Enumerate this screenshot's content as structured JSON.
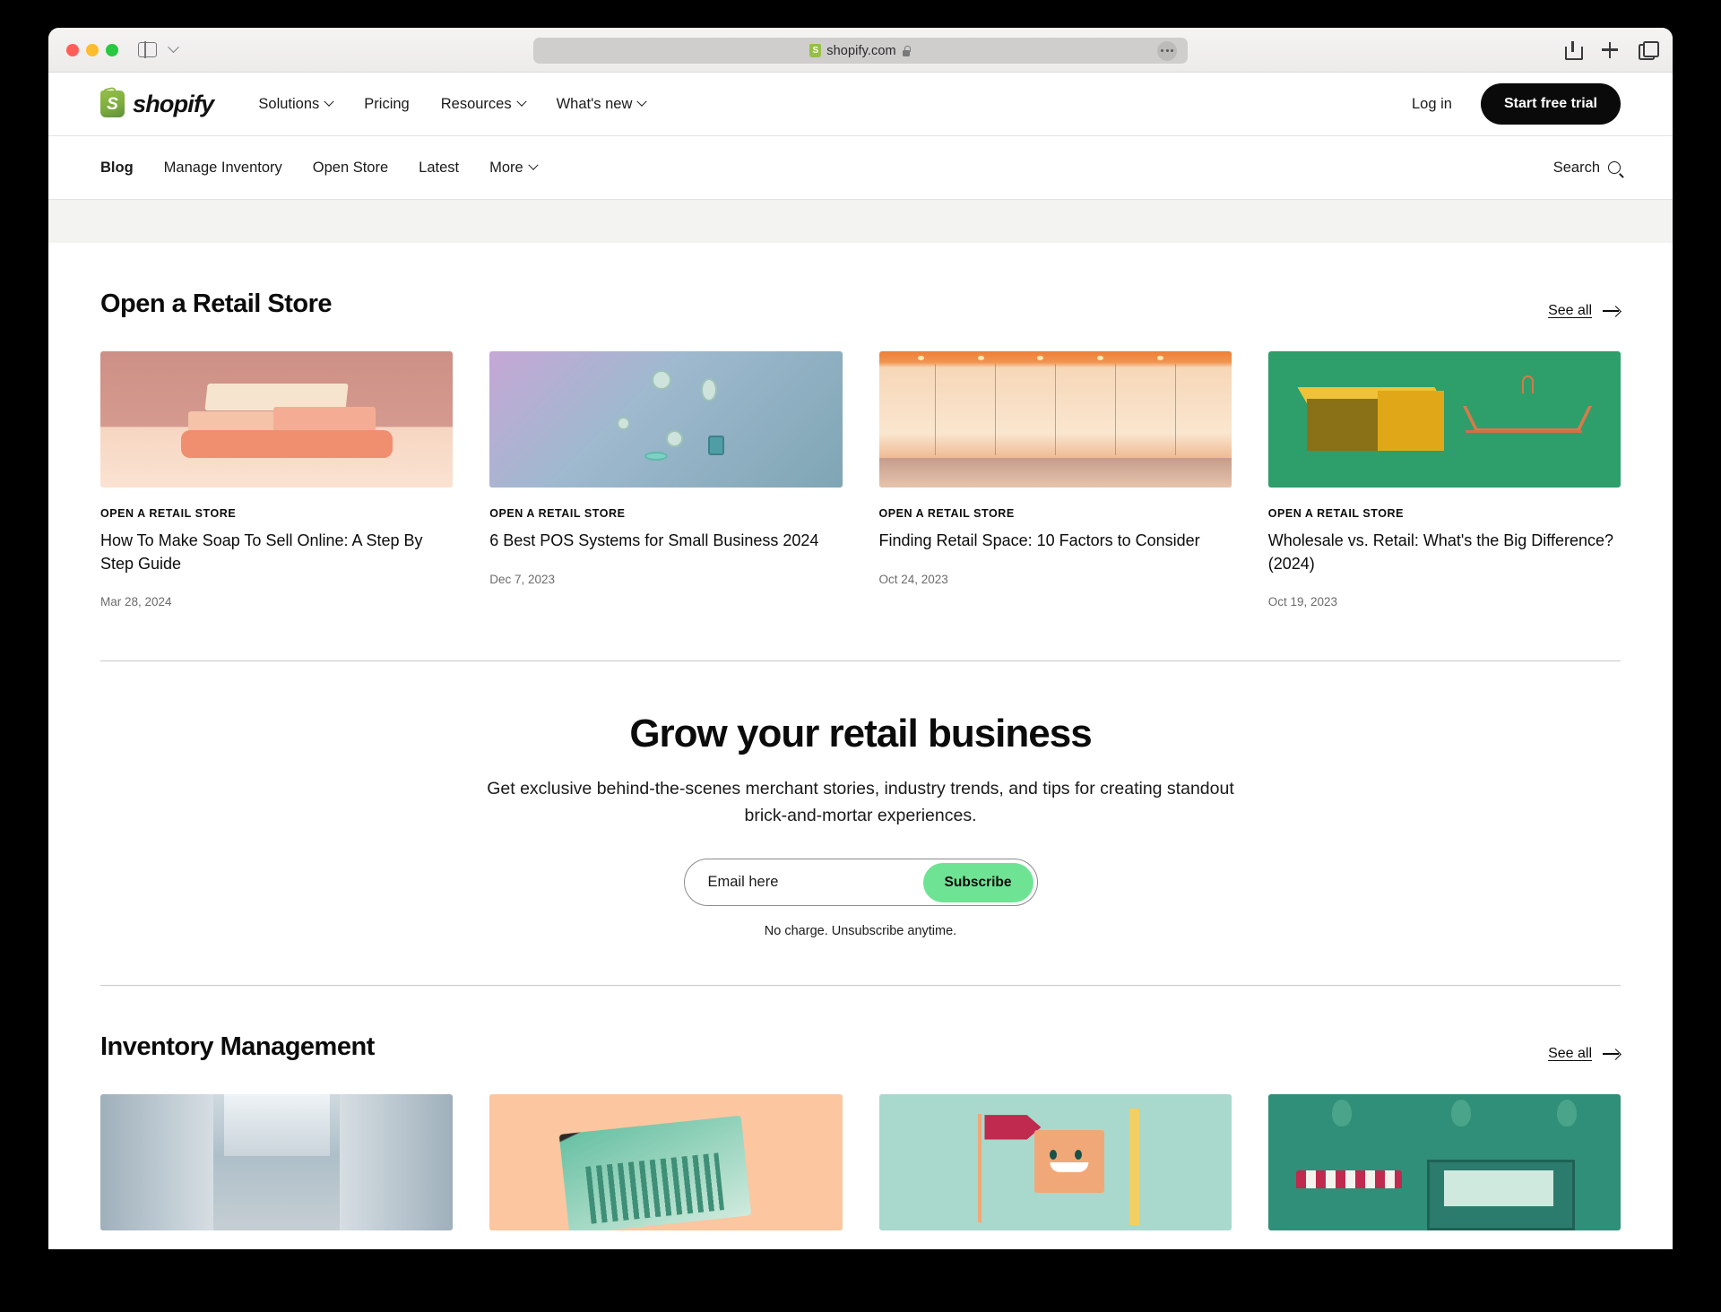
{
  "browser": {
    "url": "shopify.com",
    "favicon_icon": "shopify-favicon-icon",
    "lock_icon": "lock-icon",
    "traffic_lights": [
      "close-red",
      "minimize-yellow",
      "zoom-green"
    ],
    "sidebar_icon": "sidebar-toggle-icon",
    "tab_overview_chevron_icon": "chevron-down-icon",
    "more_icon": "ellipsis-icon",
    "share_icon": "share-icon",
    "new_tab_icon": "plus-icon",
    "tabs_icon": "tab-overview-icon"
  },
  "global_nav": {
    "brand": "shopify",
    "links": [
      {
        "label": "Solutions",
        "has_chevron": true
      },
      {
        "label": "Pricing",
        "has_chevron": false
      },
      {
        "label": "Resources",
        "has_chevron": true
      },
      {
        "label": "What's new",
        "has_chevron": true
      }
    ],
    "login_label": "Log in",
    "cta_label": "Start free trial"
  },
  "sub_nav": {
    "links": [
      {
        "label": "Blog",
        "active": true,
        "has_chevron": false
      },
      {
        "label": "Manage Inventory",
        "active": false,
        "has_chevron": false
      },
      {
        "label": "Open Store",
        "active": false,
        "has_chevron": false
      },
      {
        "label": "Latest",
        "active": false,
        "has_chevron": false
      },
      {
        "label": "More",
        "active": false,
        "has_chevron": true
      }
    ],
    "search_label": "Search",
    "search_icon": "search-icon"
  },
  "sections": [
    {
      "title": "Open a Retail Store",
      "see_all_label": "See all",
      "cards": [
        {
          "tag": "OPEN A RETAIL STORE",
          "title": "How To Make Soap To Sell Online: A Step By Step Guide",
          "date": "Mar 28, 2024",
          "art": "art-soap"
        },
        {
          "tag": "OPEN A RETAIL STORE",
          "title": "6 Best POS Systems for Small Business 2024",
          "date": "Dec 7, 2023",
          "art": "art-pos"
        },
        {
          "tag": "OPEN A RETAIL STORE",
          "title": "Finding Retail Space: 10 Factors to Consider",
          "date": "Oct 24, 2023",
          "art": "art-store"
        },
        {
          "tag": "OPEN A RETAIL STORE",
          "title": "Wholesale vs. Retail: What's the Big Difference? (2024)",
          "date": "Oct 19, 2023",
          "art": "art-green"
        }
      ]
    },
    {
      "title": "Inventory Management",
      "see_all_label": "See all",
      "cards": [
        {
          "art": "art-warehouse"
        },
        {
          "art": "art-laptop"
        },
        {
          "art": "art-mint"
        },
        {
          "art": "art-shop"
        }
      ]
    }
  ],
  "newsletter": {
    "title": "Grow your retail business",
    "subtitle": "Get exclusive behind-the-scenes merchant stories, industry trends, and tips for creating standout brick-and-mortar experiences.",
    "email_placeholder": "Email here",
    "email_value": "",
    "subscribe_label": "Subscribe",
    "note": "No charge. Unsubscribe anytime."
  },
  "colors": {
    "accent_green": "#6fe394",
    "brand_green": "#95bf47",
    "cta_black": "#0a0a0a",
    "strip": "#f3f3f1"
  }
}
